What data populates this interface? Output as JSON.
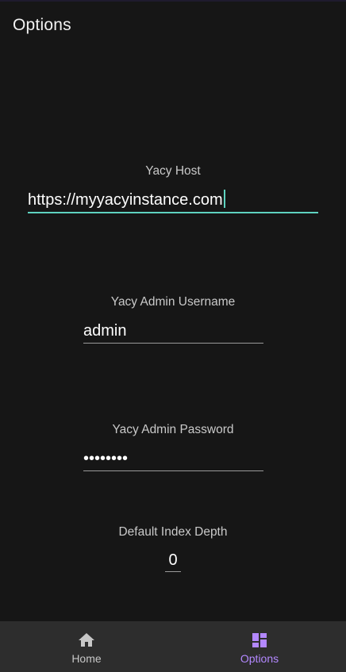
{
  "app_bar": {
    "title": "Options"
  },
  "form": {
    "host": {
      "label": "Yacy Host",
      "value": "https://myyacyinstance.com"
    },
    "username": {
      "label": "Yacy Admin Username",
      "value": "admin"
    },
    "password": {
      "label": "Yacy Admin Password",
      "masked_value": "••••••••"
    },
    "index_depth": {
      "label": "Default Index Depth",
      "value": "0"
    }
  },
  "bottom_nav": {
    "items": [
      {
        "label": "Home",
        "icon": "home-icon",
        "active": false
      },
      {
        "label": "Options",
        "icon": "dashboard-icon",
        "active": true
      }
    ]
  },
  "colors": {
    "background": "#161616",
    "focus_accent": "#5fd3c0",
    "active_nav": "#b388ff",
    "nav_background": "#2d2d2d"
  }
}
